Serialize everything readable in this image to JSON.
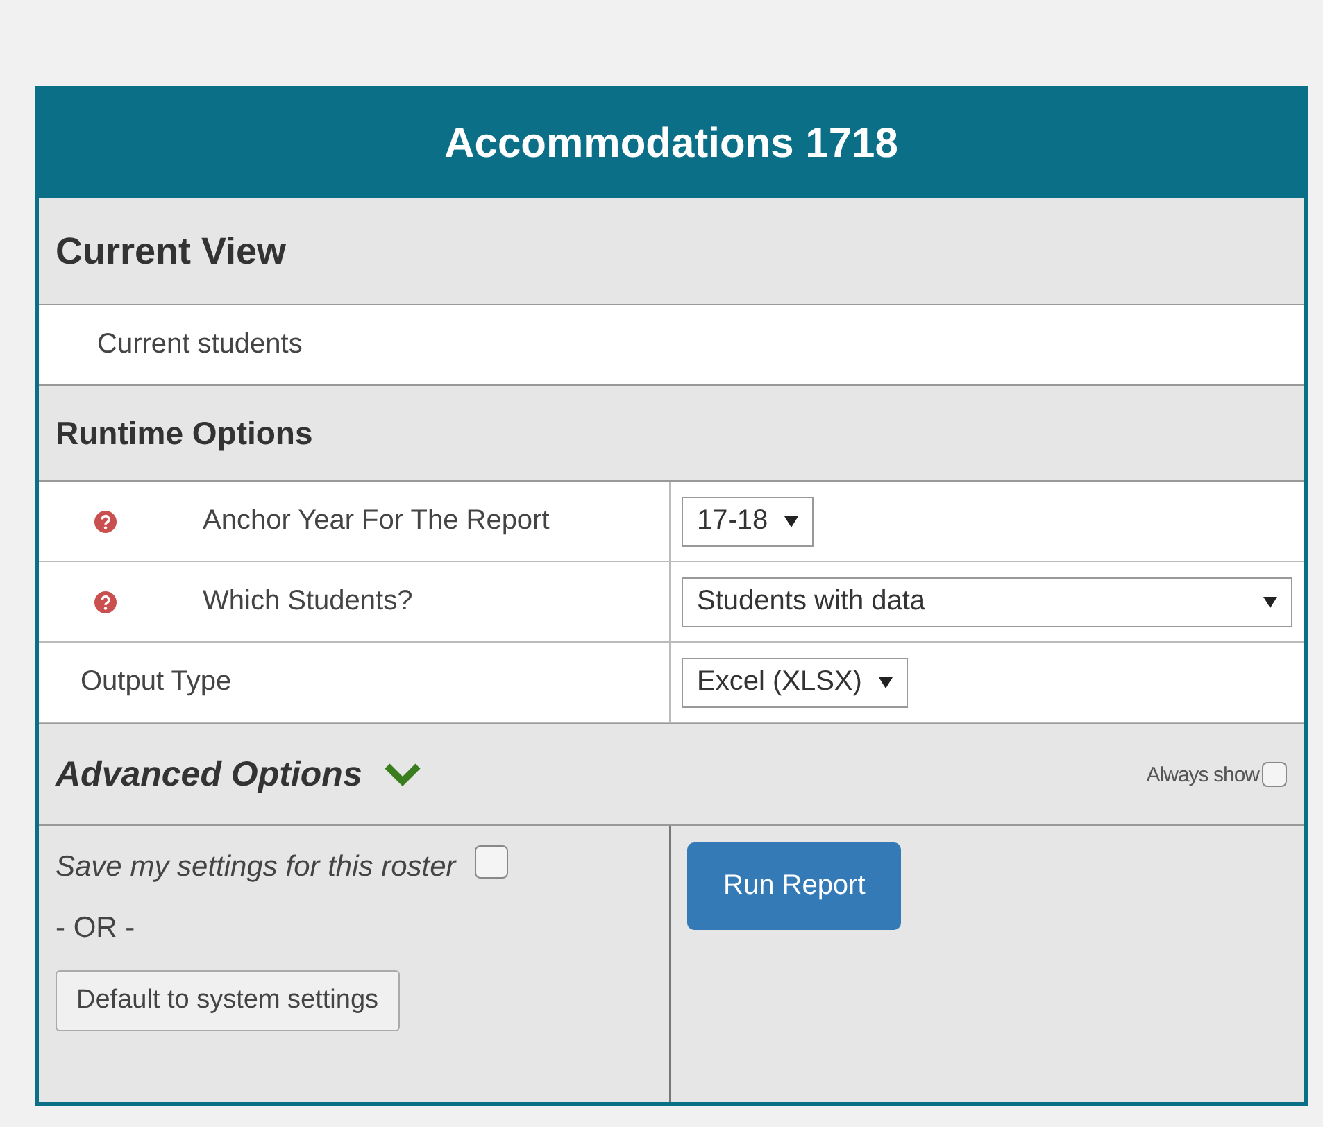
{
  "panel": {
    "title": "Accommodations 1718"
  },
  "current_view": {
    "heading": "Current View",
    "value": "Current students"
  },
  "runtime_options": {
    "heading": "Runtime Options",
    "options": [
      {
        "label": "Anchor Year For The Report",
        "help": true,
        "value": "17-18",
        "wide": false
      },
      {
        "label": "Which Students?",
        "help": true,
        "value": "Students with data",
        "wide": true
      },
      {
        "label": "Output Type",
        "help": false,
        "value": "Excel (XLSX)",
        "wide": false
      }
    ]
  },
  "advanced_options": {
    "heading": "Advanced Options",
    "expanded": true,
    "always_show": {
      "label": "Always show",
      "checked": false
    }
  },
  "footer": {
    "save_settings": {
      "label": "Save my settings for this roster",
      "checked": false
    },
    "separator": "- OR -",
    "default_button": "Default to system settings",
    "run_button": "Run Report"
  }
}
